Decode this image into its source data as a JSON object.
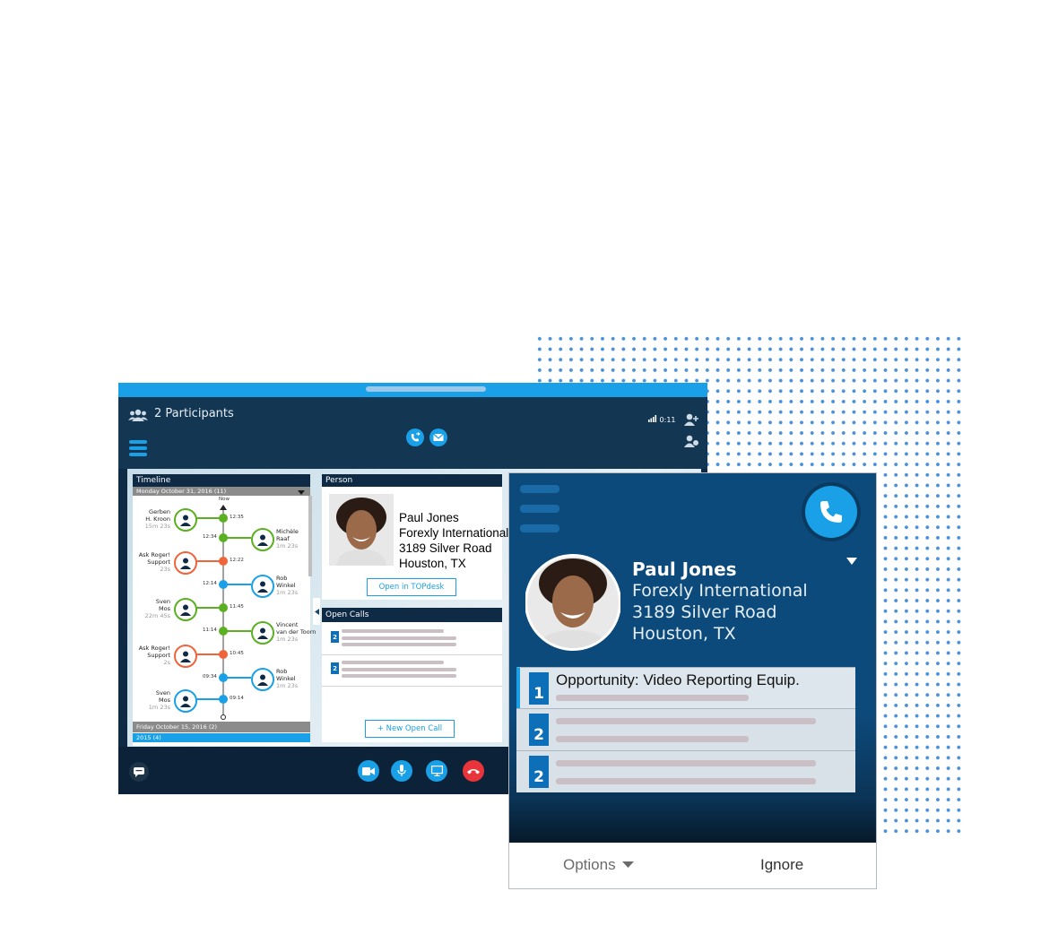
{
  "skype_window": {
    "participants_label": "2 Participants",
    "call_duration": "0:11",
    "timeline": {
      "title": "Timeline",
      "current_day": "Monday October 31, 2016 (11)",
      "now_label": "Now",
      "entries": [
        {
          "name": "Gerben\nH. Kroon",
          "duration": "15m 23s",
          "time": "12:35",
          "side": "left",
          "color": "#5ab021"
        },
        {
          "name": "Michèle\nRaaf",
          "duration": "1m 23s",
          "time": "12:34",
          "side": "right",
          "color": "#5ab021"
        },
        {
          "name": "Ask Roger!\nSupport",
          "duration": "23s",
          "time": "12:22",
          "side": "left",
          "color": "#f0643c"
        },
        {
          "name": "Rob\nWinkel",
          "duration": "1m 23s",
          "time": "12:14",
          "side": "right",
          "color": "#1aa0e6"
        },
        {
          "name": "Sven\nMos",
          "duration": "22m 45s",
          "time": "11:45",
          "side": "left",
          "color": "#5ab021"
        },
        {
          "name": "Vincent\nvan der Toorn",
          "duration": "1m 23s",
          "time": "11:14",
          "side": "right",
          "color": "#5ab021"
        },
        {
          "name": "Ask Roger!\nSupport",
          "duration": "2s",
          "time": "10:45",
          "side": "left",
          "color": "#f0643c"
        },
        {
          "name": "Rob\nWinkel",
          "duration": "1m 23s",
          "time": "09:34",
          "side": "right",
          "color": "#1aa0e6"
        },
        {
          "name": "Sven\nMos",
          "duration": "1m 23s",
          "time": "09:14",
          "side": "left",
          "color": "#1aa0e6"
        }
      ],
      "previous_day": "Friday October 15, 2016 (2)",
      "year_group": "2015 (4)"
    },
    "person": {
      "title": "Person",
      "name": "Paul Jones",
      "company": "Forexly International",
      "address": "3189 Silver Road",
      "city": "Houston, TX",
      "open_button": "Open in TOPdesk"
    },
    "open_calls": {
      "title": "Open Calls",
      "items": [
        {
          "badge": "2"
        },
        {
          "badge": "2"
        }
      ],
      "new_button": "+ New Open Call"
    }
  },
  "incoming_call": {
    "name": "Paul Jones",
    "company": "Forexly International",
    "address": "3189 Silver Road",
    "city": "Houston, TX",
    "opportunities": [
      {
        "badge": "1",
        "title": "Opportunity: Video Reporting Equip."
      },
      {
        "badge": "2",
        "title": ""
      },
      {
        "badge": "2",
        "title": ""
      }
    ],
    "options_label": "Options",
    "ignore_label": "Ignore"
  },
  "colors": {
    "accent": "#1aa0e6",
    "dark_navy": "#0e2a45",
    "popup_blue": "#0d4a7c",
    "hangup_red": "#e8343a",
    "green": "#5ab021",
    "orange": "#f0643c"
  }
}
